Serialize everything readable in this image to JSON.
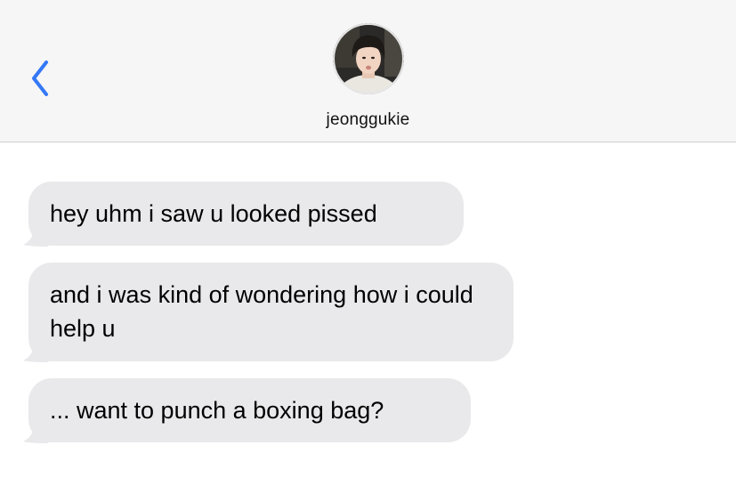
{
  "header": {
    "contact_name": "jeonggukie",
    "back_icon": "chevron-left-icon",
    "accent_color": "#3478f6"
  },
  "messages": [
    {
      "text": "hey uhm i saw u looked pissed",
      "direction": "incoming"
    },
    {
      "text": "and i was kind of wondering how i could help u",
      "direction": "incoming"
    },
    {
      "text": "... want to punch a boxing bag?",
      "direction": "incoming"
    }
  ],
  "colors": {
    "header_bg": "#f6f6f6",
    "bubble_incoming": "#e9e9eb",
    "text": "#000000"
  }
}
